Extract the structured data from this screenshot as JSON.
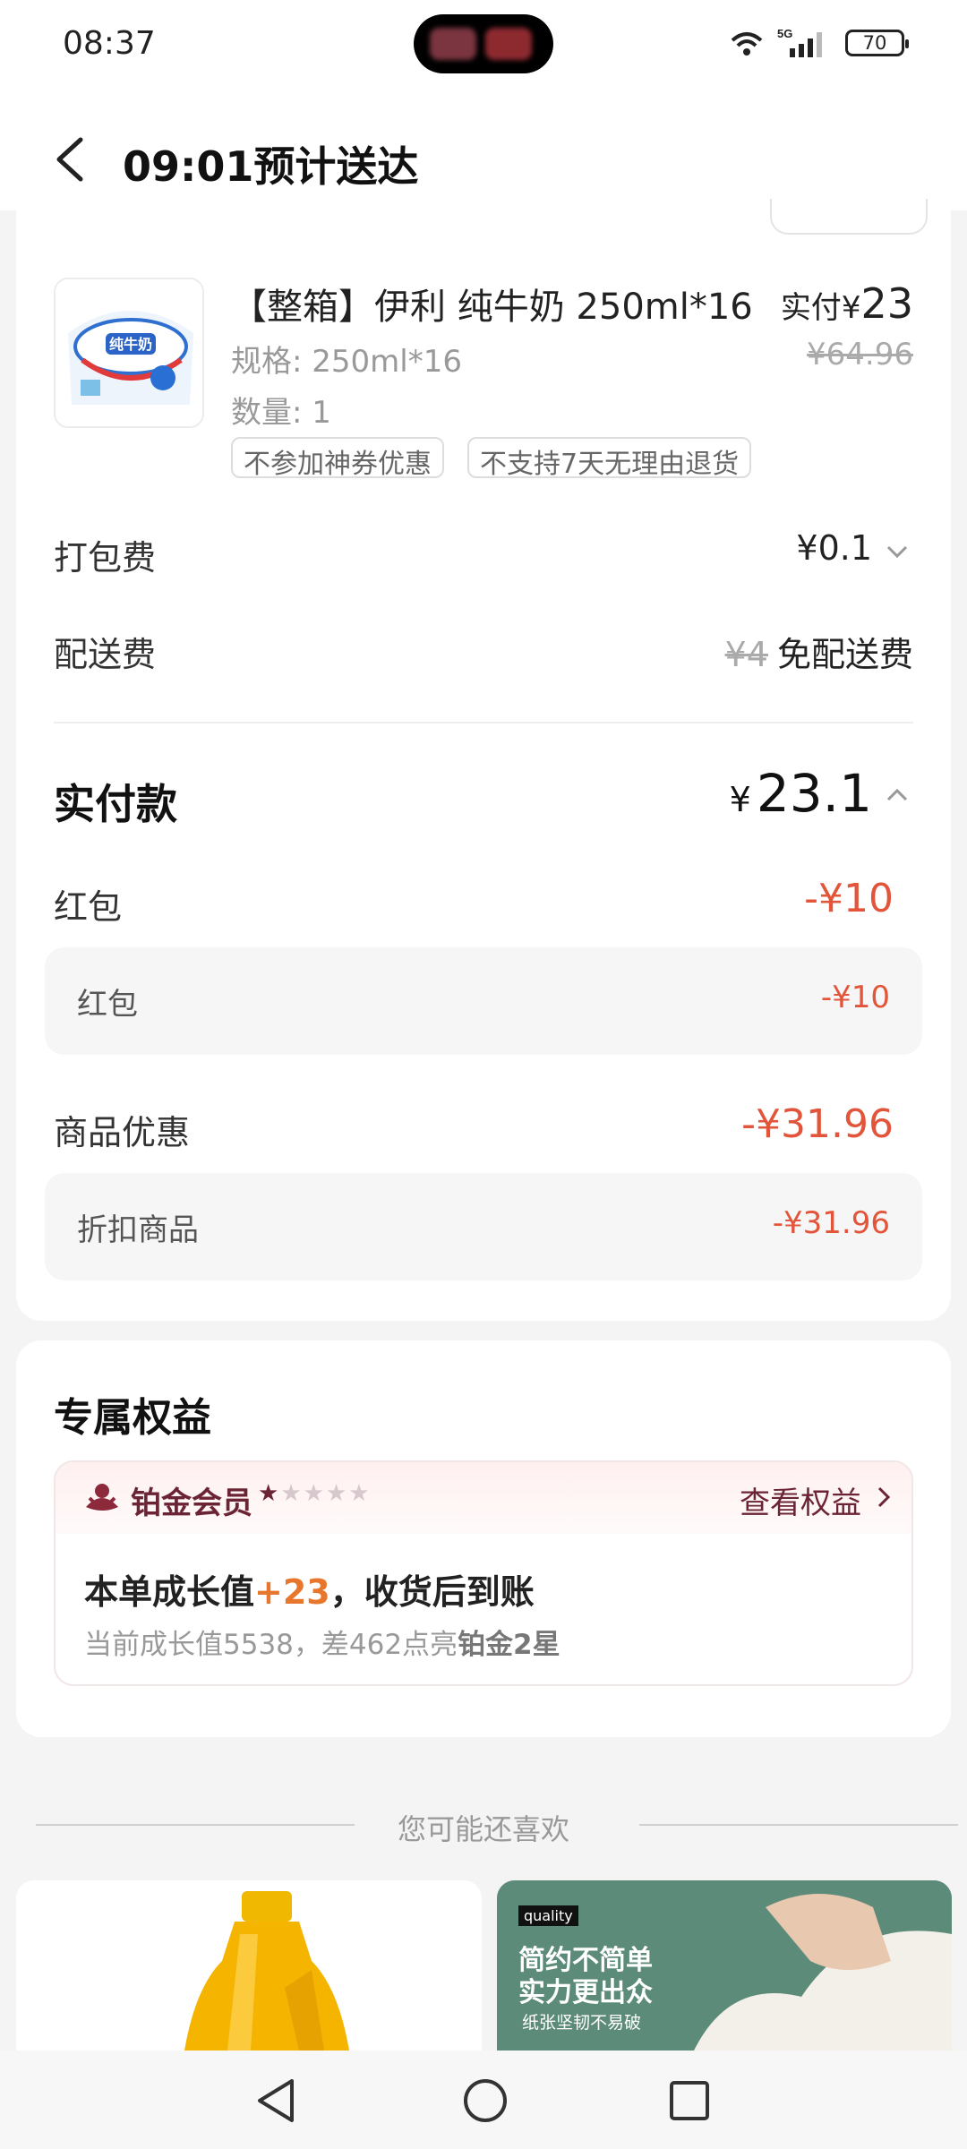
{
  "status_bar": {
    "time": "08:37",
    "network": "5G",
    "battery": "70"
  },
  "header": {
    "title": "09:01预计送达"
  },
  "product": {
    "name": "【整箱】伊利 纯牛奶 250ml*16",
    "thumb_label": "纯牛奶",
    "pay_label": "实付",
    "pay_currency": "¥",
    "pay_amount": "23",
    "original_price": "¥64.96",
    "spec": "规格: 250ml*16",
    "quantity": "数量: 1",
    "tags": [
      "不参加神券优惠",
      "不支持7天无理由退货"
    ]
  },
  "fees": {
    "packing_label": "打包费",
    "packing_value": "¥0.1",
    "delivery_label": "配送费",
    "delivery_original": "¥4",
    "delivery_value": "免配送费"
  },
  "total": {
    "label": "实付款",
    "currency": "¥",
    "amount": "23.1"
  },
  "discounts": {
    "redpacket_label": "红包",
    "redpacket_value": "-¥10",
    "redpacket_sub_label": "红包",
    "redpacket_sub_value": "-¥10",
    "goods_label": "商品优惠",
    "goods_value": "-¥31.96",
    "goods_sub_label": "折扣商品",
    "goods_sub_value": "-¥31.96"
  },
  "benefits": {
    "title": "专属权益",
    "member_level": "铂金会员",
    "stars": "★★★★★",
    "stars_filled": 1,
    "view_link": "查看权益",
    "line1_prefix": "本单成长值",
    "line1_value": "+23",
    "line1_suffix": "，收货后到账",
    "line2_prefix": "当前成长值5538，差462点亮",
    "line2_bold": "铂金2星"
  },
  "recommend": {
    "title": "您可能还喜欢",
    "ad_badge": "quality",
    "ad_line1": "简约不简单",
    "ad_line2": "实力更出众",
    "ad_line3": "纸张坚韧不易破"
  },
  "colors": {
    "discount_red": "#e2553a",
    "member_maroon": "#6b2434",
    "growth_orange": "#e8772e"
  }
}
